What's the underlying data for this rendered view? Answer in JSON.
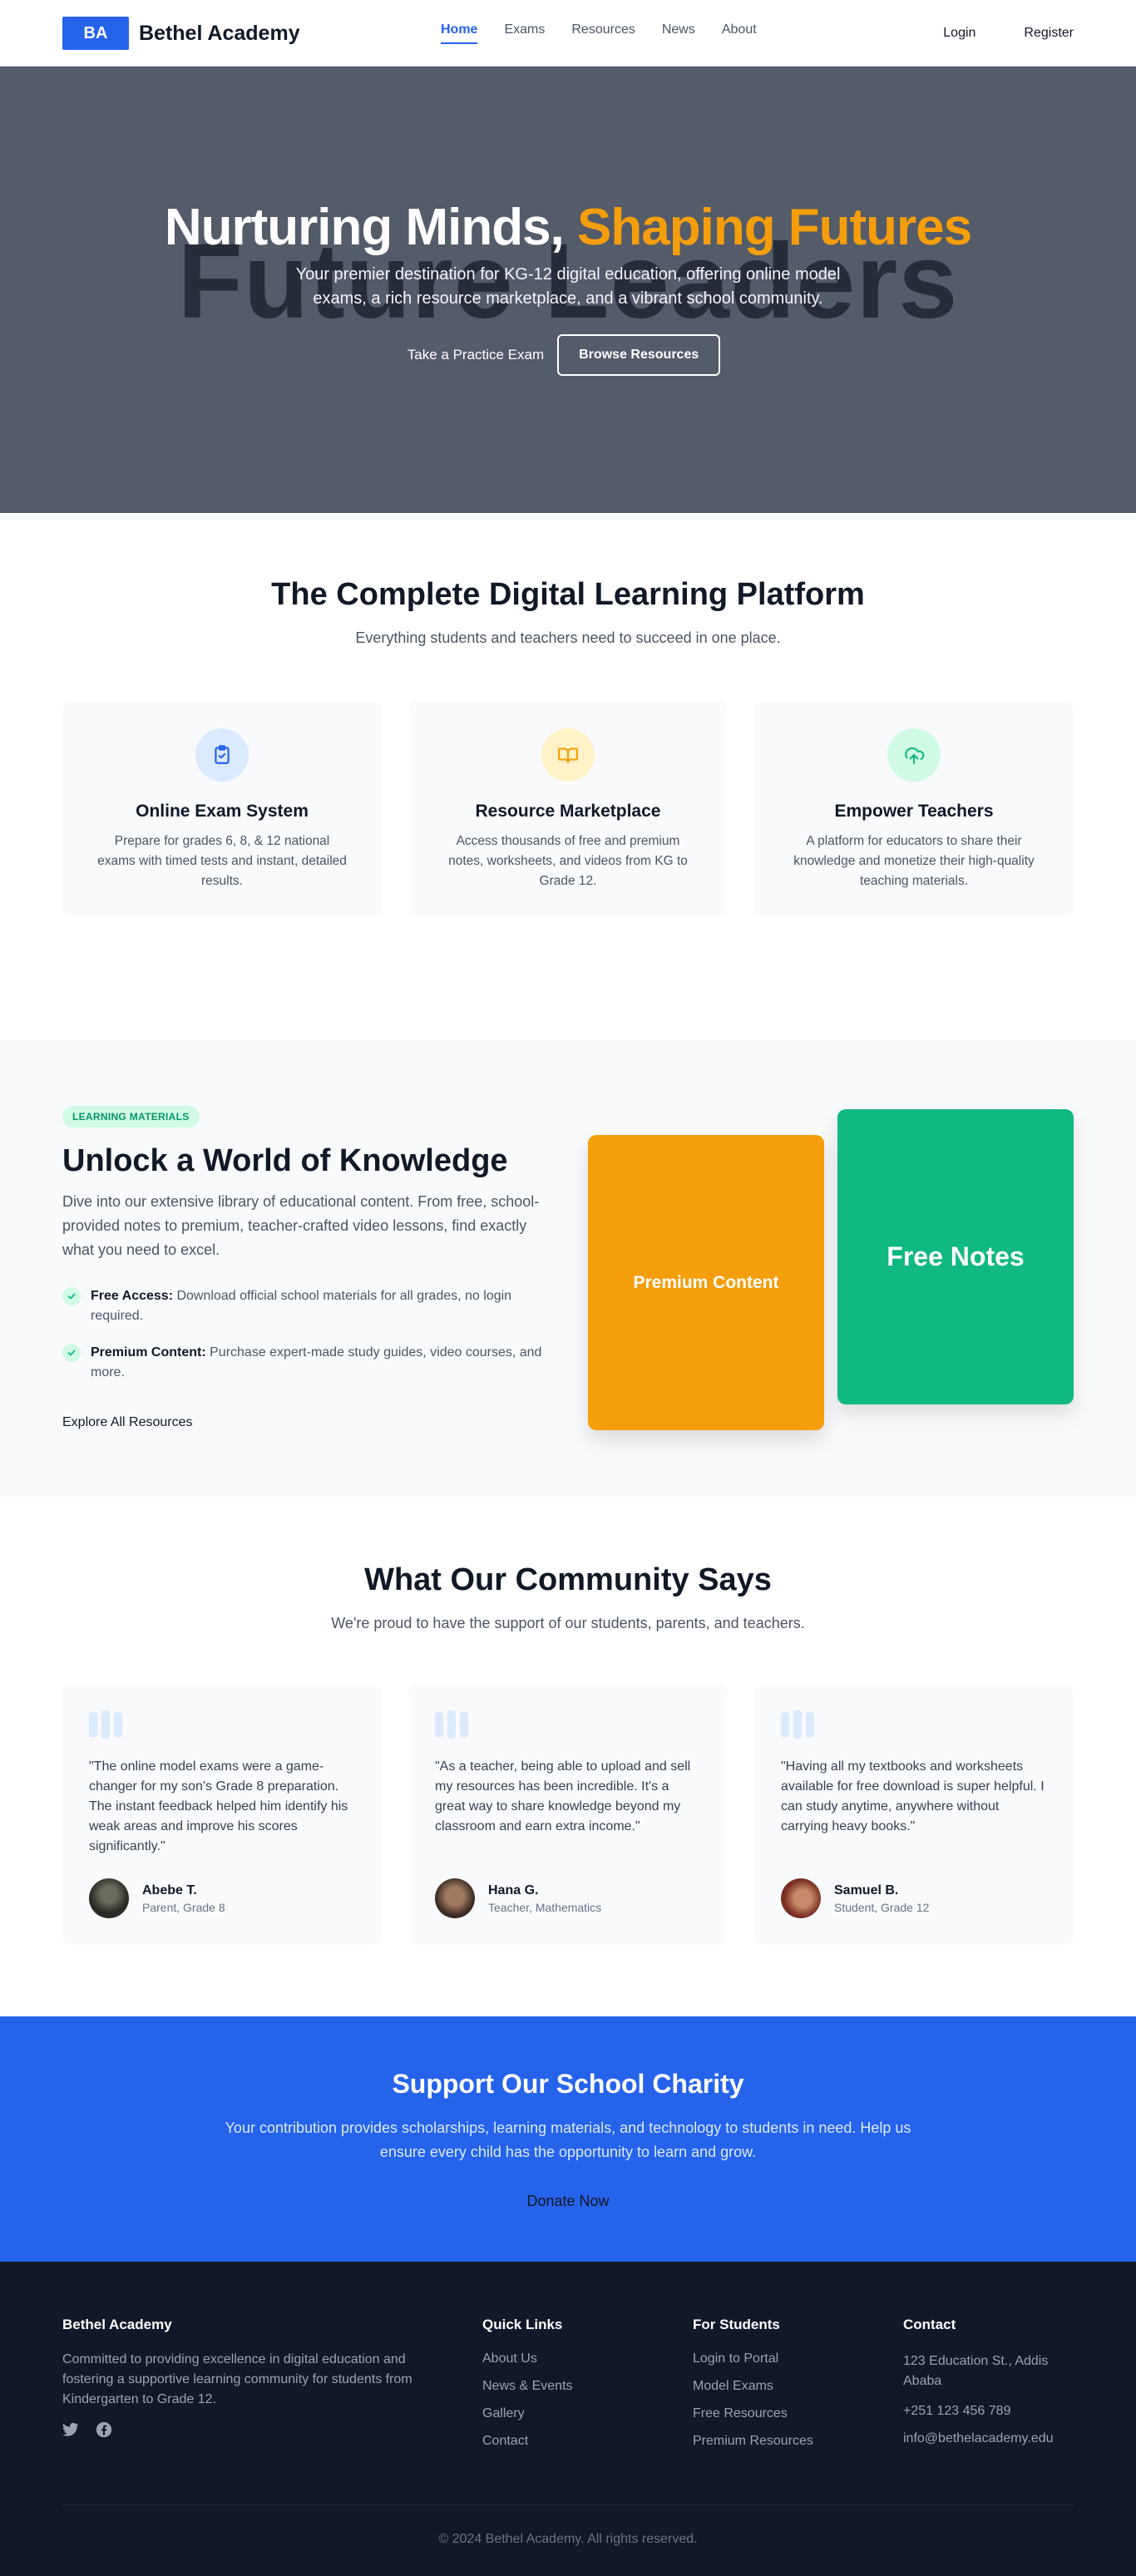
{
  "nav": {
    "logo": "BA",
    "brand": "Bethel Academy",
    "links": [
      "Home",
      "Exams",
      "Resources",
      "News",
      "About"
    ],
    "login": "Login",
    "register": "Register"
  },
  "hero": {
    "title_part1": "Nurturing Minds, ",
    "title_part2": "Shaping Futures",
    "bg_text": "Future Leaders",
    "subtitle": "Your premier destination for KG-12 digital education, offering online model exams, a rich resource marketplace, and a vibrant school community.",
    "cta_primary": "Take a Practice Exam",
    "cta_secondary": "Browse Resources"
  },
  "platform": {
    "title": "The Complete Digital Learning Platform",
    "subtitle": "Everything students and teachers need to succeed in one place.",
    "cards": [
      {
        "icon": "clipboard-check-icon",
        "title": "Online Exam System",
        "text": "Prepare for grades 6, 8, & 12 national exams with timed tests and instant, detailed results."
      },
      {
        "icon": "book-open-icon",
        "title": "Resource Marketplace",
        "text": "Access thousands of free and premium notes, worksheets, and videos from KG to Grade 12."
      },
      {
        "icon": "upload-cloud-icon",
        "title": "Empower Teachers",
        "text": "A platform for educators to share their knowledge and monetize their high-quality teaching materials."
      }
    ]
  },
  "knowledge": {
    "badge": "LEARNING MATERIALS",
    "title": "Unlock a World of Knowledge",
    "description": "Dive into our extensive library of educational content. From free, school-provided notes to premium, teacher-crafted video lessons, find exactly what you need to excel.",
    "items": [
      {
        "label": "Free Access:",
        "text": " Download official school materials for all grades, no login required."
      },
      {
        "label": "Premium Content:",
        "text": " Purchase expert-made study guides, video courses, and more."
      }
    ],
    "link": "Explore All Resources",
    "card_premium": "Premium Content",
    "card_free": "Free Notes"
  },
  "testimonials": {
    "title": "What Our Community Says",
    "subtitle": "We're proud to have the support of our students, parents, and teachers.",
    "items": [
      {
        "quote": "\"The online model exams were a game-changer for my son's Grade 8 preparation. The instant feedback helped him identify his weak areas and improve his scores significantly.\"",
        "name": "Abebe T.",
        "role": "Parent, Grade 8"
      },
      {
        "quote": "\"As a teacher, being able to upload and sell my resources has been incredible. It's a great way to share knowledge beyond my classroom and earn extra income.\"",
        "name": "Hana G.",
        "role": "Teacher, Mathematics"
      },
      {
        "quote": "\"Having all my textbooks and worksheets available for free download is super helpful. I can study anytime, anywhere without carrying heavy books.\"",
        "name": "Samuel B.",
        "role": "Student, Grade 12"
      }
    ]
  },
  "charity": {
    "title": "Support Our School Charity",
    "text": "Your contribution provides scholarships, learning materials, and technology to students in need. Help us ensure every child has the opportunity to learn and grow.",
    "button": "Donate Now"
  },
  "footer": {
    "brand": "Bethel Academy",
    "about": "Committed to providing excellence in digital education and fostering a supportive learning community for students from Kindergarten to Grade 12.",
    "quick_links_title": "Quick Links",
    "quick_links": [
      "About Us",
      "News & Events",
      "Gallery",
      "Contact"
    ],
    "students_title": "For Students",
    "students_links": [
      "Login to Portal",
      "Model Exams",
      "Free Resources",
      "Premium Resources"
    ],
    "contact_title": "Contact",
    "contact": [
      "123 Education St., Addis Ababa",
      "+251 123 456 789",
      "info@bethelacademy.edu"
    ],
    "copyright": "© 2024 Bethel Academy. All rights reserved."
  },
  "colors": {
    "primary": "#2563eb",
    "accent": "#f59e0b",
    "success": "#10b981",
    "footer_bg": "#111827"
  }
}
